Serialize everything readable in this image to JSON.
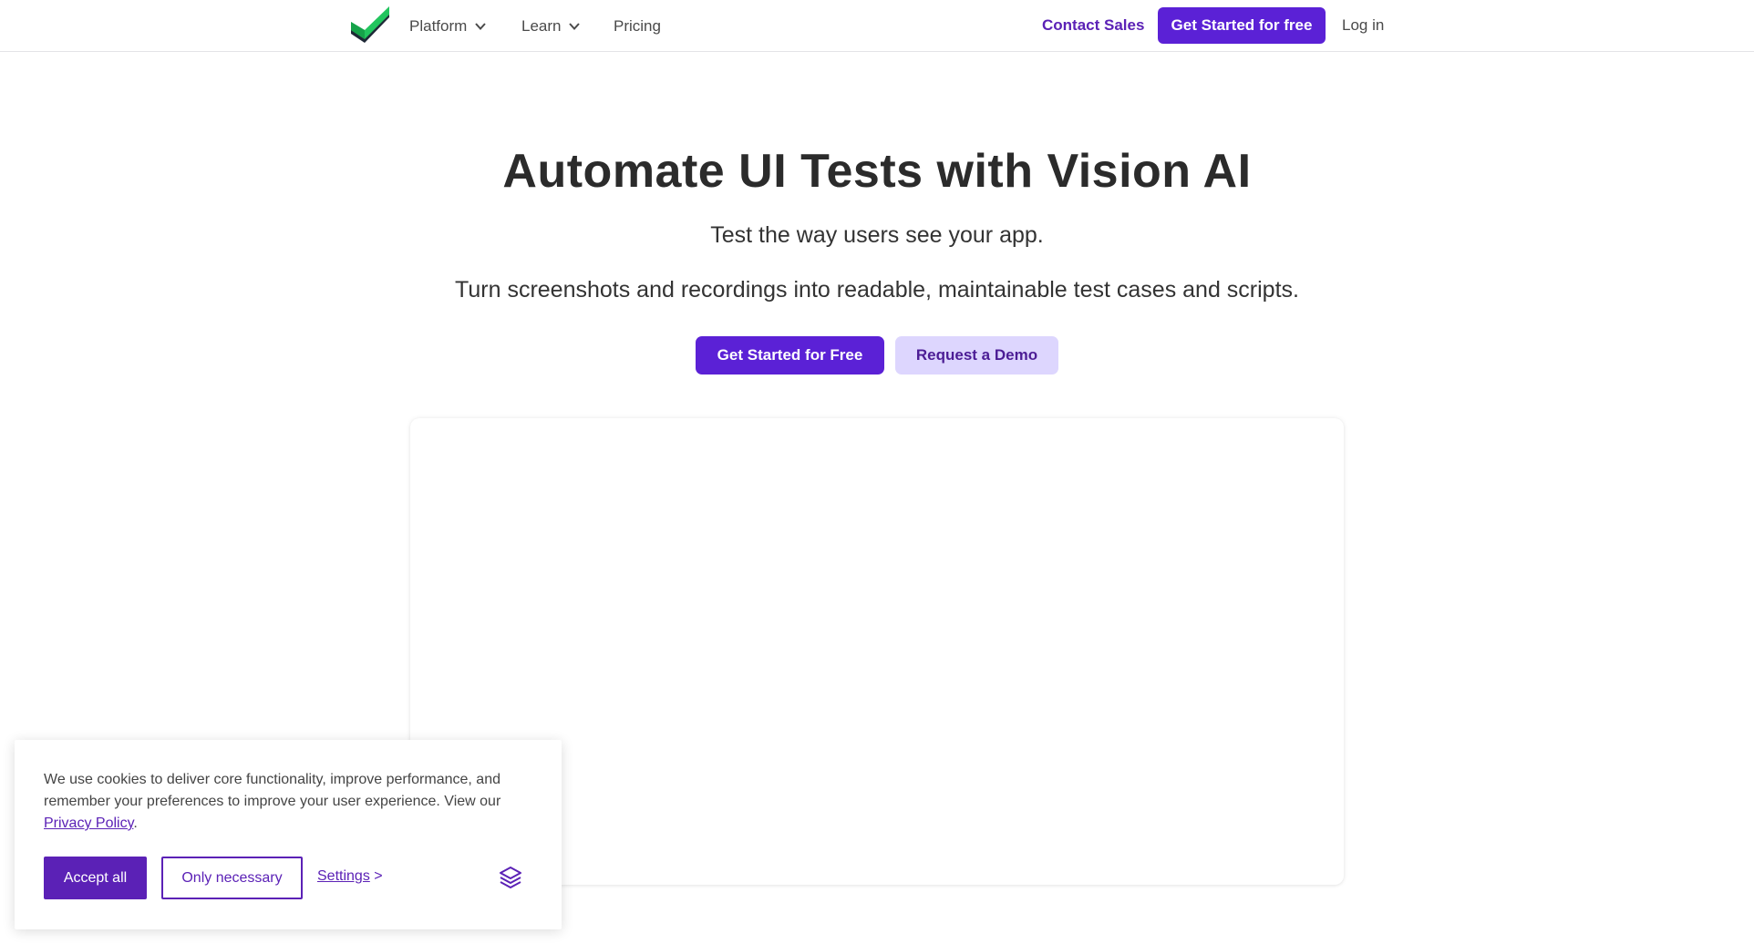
{
  "header": {
    "nav": [
      {
        "label": "Platform",
        "has_dropdown": true
      },
      {
        "label": "Learn",
        "has_dropdown": true
      },
      {
        "label": "Pricing",
        "has_dropdown": false
      }
    ],
    "contact_label": "Contact Sales",
    "cta_label": "Get Started for free",
    "login_label": "Log in"
  },
  "hero": {
    "title": "Automate UI Tests with Vision AI",
    "subtitle": "Test the way users see your app.",
    "description": "Turn screenshots and recordings into readable, maintainable test cases and scripts.",
    "primary_button": "Get Started for Free",
    "secondary_button": "Request a Demo"
  },
  "cookie": {
    "text": "We use cookies to deliver core functionality, improve performance, and remember your preferences to improve your user experience. View our ",
    "policy_link": "Privacy Policy",
    "period": ".",
    "accept_label": "Accept all",
    "necessary_label": "Only necessary",
    "settings_label": "Settings",
    "settings_arrow": ">"
  },
  "colors": {
    "brand_purple": "#5b21d6",
    "light_purple": "#ddd6fe",
    "logo_green": "#22c55e"
  },
  "icons": {
    "logo": "checkmark-logo-icon",
    "dropdown": "chevron-down-icon",
    "cookie_brand": "cookie-consent-logo-icon"
  }
}
